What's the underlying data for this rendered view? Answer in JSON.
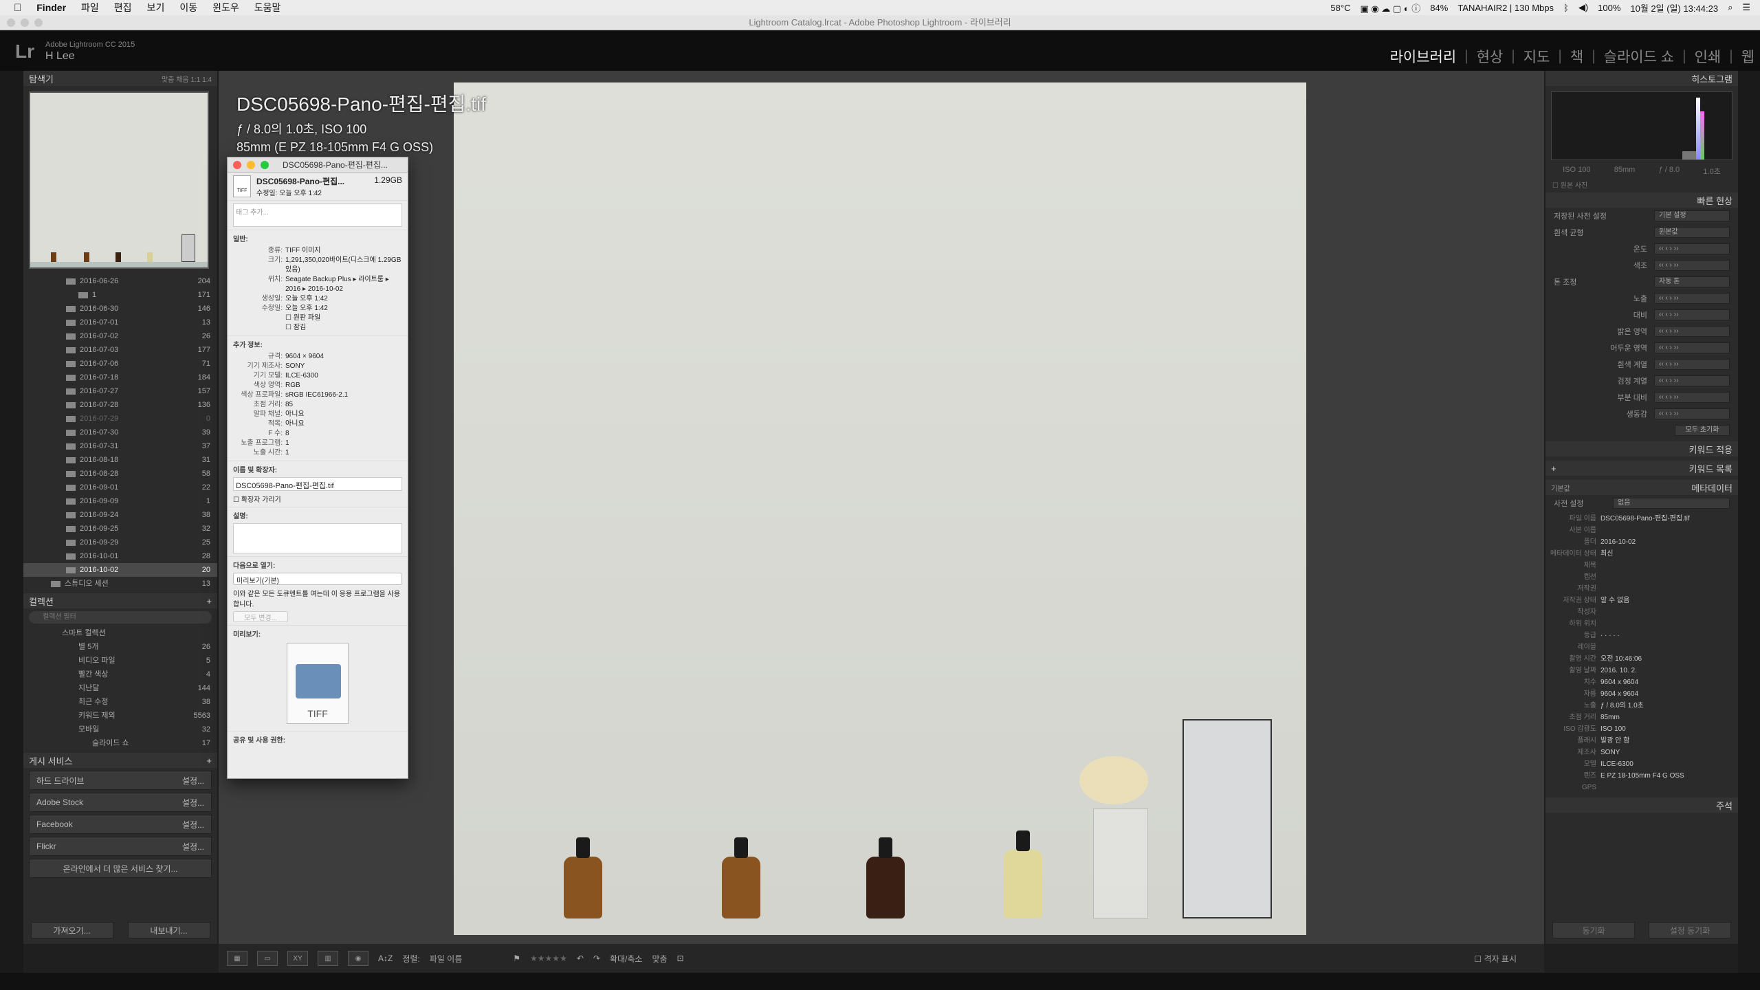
{
  "menubar": {
    "app": "Finder",
    "items": [
      "파일",
      "편집",
      "보기",
      "이동",
      "윈도우",
      "도움말"
    ],
    "status": [
      "58°C",
      "84%",
      "TANAHAIR2 | 130 Mbps",
      "100%",
      "10월 2일 (일) 13:44:23"
    ]
  },
  "window_title": "Lightroom Catalog.lrcat - Adobe Photoshop Lightroom - 라이브러리",
  "header": {
    "logo": "Lr",
    "product": "Adobe Lightroom CC 2015",
    "user": "H Lee",
    "modules": [
      "라이브러리",
      "현상",
      "지도",
      "책",
      "슬라이드 쇼",
      "인쇄",
      "웹"
    ],
    "active_module": "라이브러리"
  },
  "left": {
    "navigator_title": "탐색기",
    "navigator_options": "맞춤  채움  1:1  1:4",
    "folders": [
      {
        "name": "2016-06-26",
        "count": "204"
      },
      {
        "name": "1",
        "count": "171"
      },
      {
        "name": "2016-06-30",
        "count": "146"
      },
      {
        "name": "2016-07-01",
        "count": "13"
      },
      {
        "name": "2016-07-02",
        "count": "26"
      },
      {
        "name": "2016-07-03",
        "count": "177"
      },
      {
        "name": "2016-07-06",
        "count": "71"
      },
      {
        "name": "2016-07-18",
        "count": "184"
      },
      {
        "name": "2016-07-27",
        "count": "157"
      },
      {
        "name": "2016-07-28",
        "count": "136"
      },
      {
        "name": "2016-07-29",
        "count": "0"
      },
      {
        "name": "2016-07-30",
        "count": "39"
      },
      {
        "name": "2016-07-31",
        "count": "37"
      },
      {
        "name": "2016-08-18",
        "count": "31"
      },
      {
        "name": "2016-08-28",
        "count": "58"
      },
      {
        "name": "2016-09-01",
        "count": "22"
      },
      {
        "name": "2016-09-09",
        "count": "1"
      },
      {
        "name": "2016-09-24",
        "count": "38"
      },
      {
        "name": "2016-09-25",
        "count": "32"
      },
      {
        "name": "2016-09-29",
        "count": "25"
      },
      {
        "name": "2016-10-01",
        "count": "28"
      },
      {
        "name": "2016-10-02",
        "count": "20"
      }
    ],
    "studio_session": {
      "name": "스튜디오 세션",
      "count": "13"
    },
    "collections_title": "컬렉션",
    "collections_search": "컬렉션 필터",
    "smart_collection": "스마트 컬렉션",
    "collections": [
      {
        "name": "별 5개",
        "count": "26"
      },
      {
        "name": "비디오 파일",
        "count": "5"
      },
      {
        "name": "빨간 색상",
        "count": "4"
      },
      {
        "name": "지난달",
        "count": "144"
      },
      {
        "name": "최근 수정",
        "count": "38"
      },
      {
        "name": "키워드 제외",
        "count": "5563"
      },
      {
        "name": "모바일",
        "count": "32"
      },
      {
        "name": "슬라이드 쇼",
        "count": "17"
      }
    ],
    "publish_title": "게시 서비스",
    "publish": [
      {
        "name": "하드 드라이브",
        "action": "설정..."
      },
      {
        "name": "Adobe Stock",
        "action": "설정..."
      },
      {
        "name": "Facebook",
        "action": "설정..."
      },
      {
        "name": "Flickr",
        "action": "설정..."
      }
    ],
    "find_more": "온라인에서 더 많은 서비스 찾기...",
    "import": "가져오기...",
    "export": "내보내기..."
  },
  "photo": {
    "filename": "DSC05698-Pano-편집-편집.tif",
    "exposure": "ƒ / 8.0의 1.0초, ISO 100",
    "lens": "85mm (E PZ 18-105mm F4 G OSS)"
  },
  "info": {
    "title": "DSC05698-Pano-편집-편집...",
    "name": "DSC05698-Pano-편집...",
    "size": "1.29GB",
    "modified": "수정일:  오늘 오후 1:42",
    "tag_placeholder": "태그 추가...",
    "general_h": "일반:",
    "general": [
      {
        "k": "종류:",
        "v": "TIFF 이미지"
      },
      {
        "k": "크기:",
        "v": "1,291,350,020바이트(디스크에 1.29GB 있음)"
      },
      {
        "k": "위치:",
        "v": "Seagate Backup Plus ▸ 라이트룸 ▸ 2016 ▸ 2016-10-02"
      },
      {
        "k": "생성일:",
        "v": "오늘 오후 1:42"
      },
      {
        "k": "수정일:",
        "v": "오늘 오후 1:42"
      }
    ],
    "stationery": "원판 파일",
    "locked": "잠김",
    "more_h": "추가 정보:",
    "more": [
      {
        "k": "규격:",
        "v": "9604 × 9604"
      },
      {
        "k": "기기 제조사:",
        "v": "SONY"
      },
      {
        "k": "기기 모델:",
        "v": "ILCE-6300"
      },
      {
        "k": "색상 영역:",
        "v": "RGB"
      },
      {
        "k": "색상 프로파일:",
        "v": "sRGB IEC61966-2.1"
      },
      {
        "k": "초점 거리:",
        "v": "85"
      },
      {
        "k": "알파 채널:",
        "v": "아니요"
      },
      {
        "k": "적목:",
        "v": "아니요"
      },
      {
        "k": "F 수:",
        "v": "8"
      },
      {
        "k": "노출 프로그램:",
        "v": "1"
      },
      {
        "k": "노출 시간:",
        "v": "1"
      }
    ],
    "name_h": "이름 및 확장자:",
    "name_value": "DSC05698-Pano-편집-편집.tif",
    "hide_ext": "확장자 가리기",
    "comments_h": "설명:",
    "open_with_h": "다음으로 열기:",
    "open_with_value": "미리보기(기본)",
    "open_with_note": "이와 같은 모든 도큐멘트를 여는데 이 응용 프로그램을 사용합니다.",
    "change_all": "모두 변경...",
    "preview_h": "미리보기:",
    "preview_label": "TIFF",
    "sharing_h": "공유 및 사용 권한:"
  },
  "toolbar": {
    "sort_label": "정렬:",
    "sort_value": "파일 이름",
    "zoom_label": "확대/축소",
    "fit_label": "맞춤",
    "grid_label": "격자 표시"
  },
  "right": {
    "histogram_title": "히스토그램",
    "hist_labels": [
      "ISO 100",
      "85mm",
      "ƒ / 8.0",
      "1.0초"
    ],
    "original_photo": "원본 사진",
    "quick_develop": "빠른 현상",
    "saved_preset": "저장된 사전 설정",
    "saved_preset_value": "기본 설정",
    "white_balance": "흰색 균형",
    "white_balance_value": "원본값",
    "temp": "온도",
    "tint": "색조",
    "tone": "톤 조정",
    "auto_tone": "자동 톤",
    "tone_rows": [
      "노출",
      "대비",
      "밝은 영역",
      "어두운 영역",
      "흰색 계열",
      "검정 계열",
      "부분 대비",
      "생동감"
    ],
    "reset_all": "모두 초기화",
    "keyword_apply": "키워드 적용",
    "keyword_list": "키워드 목록",
    "metadata_title": "메타데이터",
    "metadata_preset": "기본값",
    "preset_label": "사전 설정",
    "preset_value": "없음",
    "metadata": [
      {
        "k": "파일 이름",
        "v": "DSC05698-Pano-편집-편집.tif"
      },
      {
        "k": "사본 이름",
        "v": ""
      },
      {
        "k": "폴더",
        "v": "2016-10-02"
      },
      {
        "k": "메타데이터 상태",
        "v": "최신"
      },
      {
        "k": "제목",
        "v": ""
      },
      {
        "k": "캡션",
        "v": ""
      },
      {
        "k": "저작권",
        "v": ""
      },
      {
        "k": "저작권 상태",
        "v": "알 수 없음"
      },
      {
        "k": "작성자",
        "v": ""
      },
      {
        "k": "하위 위치",
        "v": ""
      },
      {
        "k": "등급",
        "v": "· · · · ·"
      },
      {
        "k": "레이블",
        "v": ""
      },
      {
        "k": "촬영 시간",
        "v": "오전 10:46:06"
      },
      {
        "k": "촬영 날짜",
        "v": "2016. 10. 2."
      },
      {
        "k": "치수",
        "v": "9604 x 9604"
      },
      {
        "k": "자름",
        "v": "9604 x 9604"
      },
      {
        "k": "노출",
        "v": "ƒ / 8.0의 1.0초"
      },
      {
        "k": "초점 거리",
        "v": "85mm"
      },
      {
        "k": "ISO 감광도",
        "v": "ISO 100"
      },
      {
        "k": "플래시",
        "v": "발광 안 함"
      },
      {
        "k": "제조사",
        "v": "SONY"
      },
      {
        "k": "모델",
        "v": "ILCE-6300"
      },
      {
        "k": "렌즈",
        "v": "E PZ 18-105mm F4 G OSS"
      },
      {
        "k": "GPS",
        "v": ""
      }
    ],
    "comments_title": "주석",
    "sync": "동기화",
    "sync_settings": "설정 동기화"
  }
}
